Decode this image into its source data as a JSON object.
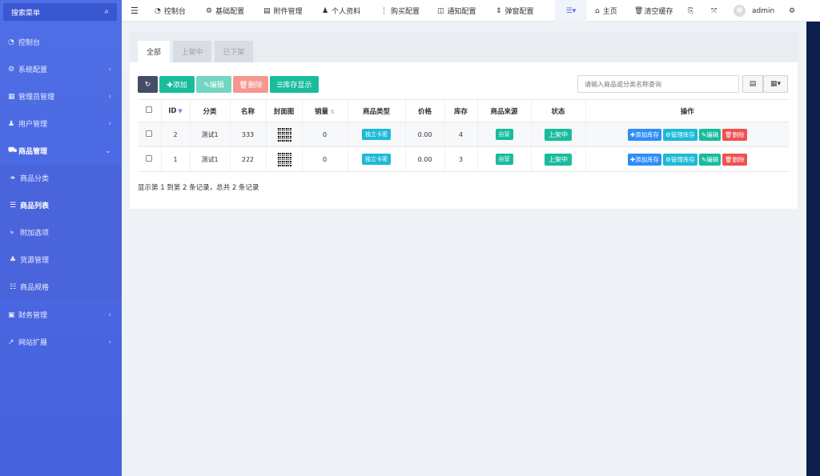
{
  "sidebar": {
    "search_label": "搜索菜单",
    "items": [
      {
        "label": "控制台",
        "icon": "dashboard-icon",
        "glyph": "◔",
        "arrow": ""
      },
      {
        "label": "系统配置",
        "icon": "cogs-icon",
        "glyph": "⚙",
        "arrow": "‹"
      },
      {
        "label": "管理员管理",
        "icon": "id-card-icon",
        "glyph": "▦",
        "arrow": "‹"
      },
      {
        "label": "用户管理",
        "icon": "user-icon",
        "glyph": "♟",
        "arrow": "‹"
      },
      {
        "label": "商品管理",
        "icon": "cart-icon",
        "glyph": "⛟",
        "arrow": "⌄"
      },
      {
        "label": "商品分类",
        "icon": "leaf-icon",
        "glyph": "❧",
        "arrow": ""
      },
      {
        "label": "商品列表",
        "icon": "list-icon",
        "glyph": "☰",
        "arrow": ""
      },
      {
        "label": "附加选项",
        "icon": "angle-double-right-icon",
        "glyph": "»",
        "arrow": ""
      },
      {
        "label": "货源管理",
        "icon": "sitemap-icon",
        "glyph": "♣",
        "arrow": ""
      },
      {
        "label": "商品规格",
        "icon": "sliders-icon",
        "glyph": "☷",
        "arrow": ""
      },
      {
        "label": "财务管理",
        "icon": "money-icon",
        "glyph": "▣",
        "arrow": "‹"
      },
      {
        "label": "网站扩展",
        "icon": "external-link-icon",
        "glyph": "↗",
        "arrow": "‹"
      }
    ]
  },
  "topbar": {
    "menu_glyph": "☰",
    "nav": [
      {
        "label": "控制台",
        "icon": "dashboard-icon",
        "glyph": "◔"
      },
      {
        "label": "基础配置",
        "icon": "gear-icon",
        "glyph": "⚙"
      },
      {
        "label": "附件管理",
        "icon": "file-image-icon",
        "glyph": "▤"
      },
      {
        "label": "个人资料",
        "icon": "user-icon",
        "glyph": "♟"
      },
      {
        "label": "购买配置",
        "icon": "ellipsis-v-icon",
        "glyph": "⋮"
      },
      {
        "label": "通知配置",
        "icon": "comment-icon",
        "glyph": "◫"
      },
      {
        "label": "弹窗配置",
        "icon": "sort-icon",
        "glyph": "⇕"
      }
    ],
    "more_glyph": "☰▾",
    "home_label": "主页",
    "home_glyph": "⌂",
    "cache_label": "清空缓存",
    "cache_glyph": "🗑",
    "lang_glyph": "⎘",
    "fullscreen_glyph": "⤧",
    "admin_label": "admin",
    "settings_glyph": "⚙"
  },
  "tabs": [
    "全部",
    "上架中",
    "已下架"
  ],
  "toolbar": {
    "refresh_glyph": "↻",
    "add_label": "✚添加",
    "edit_label": "✎编辑",
    "delete_label": "🗑删除",
    "stock_label": "☰库存显示",
    "search_placeholder": "请输入商品或分类名称查询",
    "toggle_glyph": "▤",
    "columns_glyph": "▦▾"
  },
  "table": {
    "headers": [
      "ID",
      "分类",
      "名称",
      "封面图",
      "销量",
      "商品类型",
      "价格",
      "库存",
      "商品来源",
      "状态",
      "操作"
    ],
    "id_sort_glyph": "▼",
    "sales_sort_glyph": "⇅",
    "rows": [
      {
        "id": "2",
        "category": "测试1",
        "name": "333",
        "sales": "0",
        "type": "独立卡密",
        "price": "0.00",
        "stock": "4",
        "source": "自营",
        "status": "上架中"
      },
      {
        "id": "1",
        "category": "测试1",
        "name": "222",
        "sales": "0",
        "type": "独立卡密",
        "price": "0.00",
        "stock": "3",
        "source": "自营",
        "status": "上架中"
      }
    ],
    "ops": {
      "add_stock": "✚添加库存",
      "manage_stock": "⚙管理库存",
      "edit": "✎编辑",
      "delete": "🗑删除"
    }
  },
  "footer_text": "显示第 1 到第 2 条记录，总共 2 条记录",
  "colors": {
    "sidebar": "#4f6fe6",
    "success": "#18bc9c",
    "primary": "#2c8ef8",
    "danger": "#f05050",
    "info": "#1cbad6",
    "dark": "#444c66"
  }
}
